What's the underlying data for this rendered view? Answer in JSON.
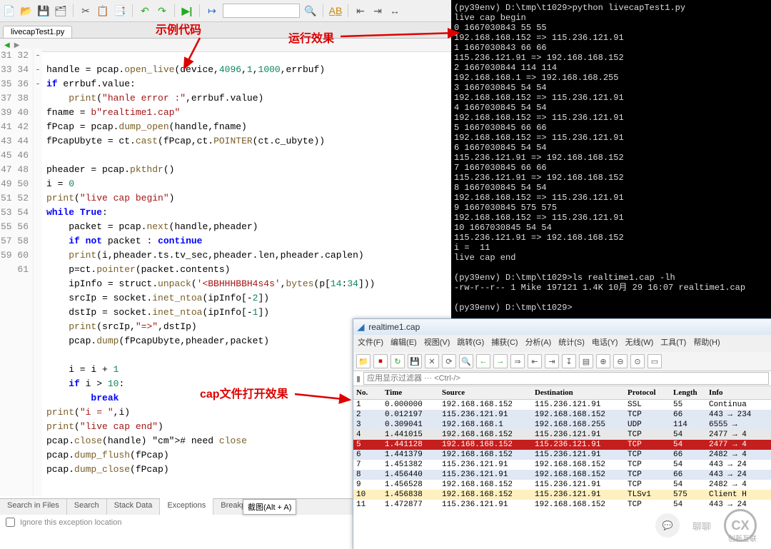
{
  "toolbar_icons": [
    "new-file",
    "open-folder",
    "save",
    "save-all",
    "",
    "cut",
    "clipboard",
    "copy",
    "",
    "undo",
    "redo",
    "",
    "run-green",
    "",
    "step",
    "",
    "",
    "",
    "",
    "find-replace",
    "",
    "in-left",
    "in-right",
    "stretch"
  ],
  "search_placeholder": "",
  "tab_filename": "livecapTest1.py",
  "annotations": {
    "example_code": "示例代码",
    "run_effect": "运行效果",
    "cap_open": "cap文件打开效果"
  },
  "code": {
    "first_line": 31,
    "folds": {
      "33": "-",
      "42": "-",
      "54": "-"
    },
    "lines": [
      "",
      "handle = pcap.open_live(device,4096,1,1000,errbuf)",
      "if errbuf.value:",
      "    print(\"hanle error :\",errbuf.value)",
      "fname = b\"realtime1.cap\"",
      "fPcap = pcap.dump_open(handle,fname)",
      "fPcapUbyte = ct.cast(fPcap,ct.POINTER(ct.c_ubyte))",
      "",
      "pheader = pcap.pkthdr()",
      "i = 0",
      "print(\"live cap begin\")",
      "while True:",
      "    packet = pcap.next(handle,pheader)",
      "    if not packet : continue",
      "    print(i,pheader.ts.tv_sec,pheader.len,pheader.caplen)",
      "    p=ct.pointer(packet.contents)",
      "    ipInfo = struct.unpack('<BBHHHBBH4s4s',bytes(p[14:34]))",
      "    srcIp = socket.inet_ntoa(ipInfo[-2])",
      "    dstIp = socket.inet_ntoa(ipInfo[-1])",
      "    print(srcIp,\"=>\",dstIp)",
      "    pcap.dump(fPcapUbyte,pheader,packet)",
      "",
      "    i = i + 1",
      "    if i > 10:",
      "        break",
      "print(\"i = \",i)",
      "print(\"live cap end\")",
      "pcap.close(handle) # need close",
      "pcap.dump_flush(fPcap)",
      "pcap.dump_close(fPcap)",
      ""
    ]
  },
  "bottom_tabs": [
    "Search in Files",
    "Search",
    "Stack Data",
    "Exceptions",
    "Breakpoi"
  ],
  "bottom_active": 3,
  "ignore_label": "Ignore this exception location",
  "screenshot_badge": "截图(Alt + A)",
  "terminal": "(py39env) D:\\tmp\\t1029>python livecapTest1.py\nlive cap begin\n0 1667030843 55 55\n192.168.168.152 => 115.236.121.91\n1 1667030843 66 66\n115.236.121.91 => 192.168.168.152\n2 1667030844 114 114\n192.168.168.1 => 192.168.168.255\n3 1667030845 54 54\n192.168.168.152 => 115.236.121.91\n4 1667030845 54 54\n192.168.168.152 => 115.236.121.91\n5 1667030845 66 66\n192.168.168.152 => 115.236.121.91\n6 1667030845 54 54\n115.236.121.91 => 192.168.168.152\n7 1667030845 66 66\n115.236.121.91 => 192.168.168.152\n8 1667030845 54 54\n192.168.168.152 => 115.236.121.91\n9 1667030845 575 575\n192.168.168.152 => 115.236.121.91\n10 1667030845 54 54\n115.236.121.91 => 192.168.168.152\ni =  11\nlive cap end\n\n(py39env) D:\\tmp\\t1029>ls realtime1.cap -lh\n-rw-r--r-- 1 Mike 197121 1.4K 10月 29 16:07 realtime1.cap\n\n(py39env) D:\\tmp\\t1029>",
  "ws": {
    "title": "realtime1.cap",
    "menu": [
      "文件(F)",
      "编辑(E)",
      "视图(V)",
      "跳转(G)",
      "捕获(C)",
      "分析(A)",
      "统计(S)",
      "电话(Y)",
      "无线(W)",
      "工具(T)",
      "帮助(H)"
    ],
    "filter_placeholder": "应用显示过滤器 ··· <Ctrl-/>",
    "head": [
      "No.",
      "Time",
      "Source",
      "Destination",
      "Protocol",
      "Length",
      "Info"
    ],
    "rows": [
      {
        "cls": "",
        "c": [
          "1",
          "0.000000",
          "192.168.168.152",
          "115.236.121.91",
          "SSL",
          "55",
          "Continua"
        ]
      },
      {
        "cls": "blue",
        "c": [
          "2",
          "0.012197",
          "115.236.121.91",
          "192.168.168.152",
          "TCP",
          "66",
          "443 → 234"
        ]
      },
      {
        "cls": "blue",
        "c": [
          "3",
          "0.309041",
          "192.168.168.1",
          "192.168.168.255",
          "UDP",
          "114",
          "6555 → "
        ]
      },
      {
        "cls": "gray",
        "c": [
          "4",
          "1.441015",
          "192.168.168.152",
          "115.236.121.91",
          "TCP",
          "54",
          "2477 → 4"
        ]
      },
      {
        "cls": "red",
        "c": [
          "5",
          "1.441128",
          "192.168.168.152",
          "115.236.121.91",
          "TCP",
          "54",
          "2477 → 4"
        ]
      },
      {
        "cls": "blue",
        "c": [
          "6",
          "1.441379",
          "192.168.168.152",
          "115.236.121.91",
          "TCP",
          "66",
          "2482 → 4"
        ]
      },
      {
        "cls": "",
        "c": [
          "7",
          "1.451382",
          "115.236.121.91",
          "192.168.168.152",
          "TCP",
          "54",
          "443 → 24"
        ]
      },
      {
        "cls": "blue",
        "c": [
          "8",
          "1.456440",
          "115.236.121.91",
          "192.168.168.152",
          "TCP",
          "66",
          "443 → 24"
        ]
      },
      {
        "cls": "",
        "c": [
          "9",
          "1.456528",
          "192.168.168.152",
          "115.236.121.91",
          "TCP",
          "54",
          "2482 → 4"
        ]
      },
      {
        "cls": "yel",
        "c": [
          "10",
          "1.456838",
          "192.168.168.152",
          "115.236.121.91",
          "TLSv1",
          "575",
          "Client H"
        ]
      },
      {
        "cls": "",
        "c": [
          "11",
          "1.472877",
          "115.236.121.91",
          "192.168.168.152",
          "TCP",
          "54",
          "443 → 24"
        ]
      }
    ]
  },
  "watermark": {
    "chat": "聊聊",
    "brand": "创新互联"
  }
}
